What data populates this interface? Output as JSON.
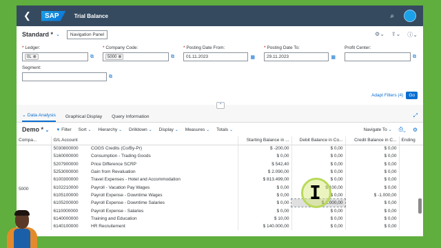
{
  "shell": {
    "logo": "SAP",
    "title": "Trial Balance"
  },
  "variant": {
    "name": "Standard *",
    "nav_panel": "Navigation Panel"
  },
  "filters": {
    "ledger": {
      "label": "Ledger:",
      "token": "0L"
    },
    "company_code": {
      "label": "Company Code:",
      "token": "5000"
    },
    "posting_from": {
      "label": "Posting Date From:",
      "value": "01.11.2023"
    },
    "posting_to": {
      "label": "Posting Date To:",
      "value": "29.11.2023"
    },
    "profit_center": {
      "label": "Profit Center:",
      "value": ""
    },
    "segment": {
      "label": "Segment:",
      "value": ""
    },
    "adapt_label": "Adapt Filters (4)",
    "go_label": "Go"
  },
  "tabs": [
    {
      "label": "Data Analysis"
    },
    {
      "label": "Graphical Display"
    },
    {
      "label": "Query Information"
    }
  ],
  "toolbar": {
    "view": "Demo *",
    "filter": "Filter",
    "sort": "Sort",
    "hierarchy": "Hierarchy",
    "drilldown": "Drilldown",
    "display": "Display",
    "measures": "Measures",
    "totals": "Totals",
    "navigate_to": "Navigate To"
  },
  "table": {
    "columns": [
      "Compa...",
      "G/L Account",
      "",
      "Starting Balance in ...",
      "Debit Balance in Co...",
      "Credit Balance in C...",
      "Ending"
    ],
    "company": "5000",
    "rows": [
      {
        "acct": "5030800000",
        "name": "COGS Credits (Co/By-Pr)",
        "start": "$ -200,00",
        "debit": "$ 0,00",
        "credit": "$ 0,00"
      },
      {
        "acct": "5160000000",
        "name": "Consumption - Trading Goods",
        "start": "$ 0,00",
        "debit": "$ 0,00",
        "credit": "$ 0,00"
      },
      {
        "acct": "5207900000",
        "name": "Price Difference SCRP",
        "start": "$ 542,40",
        "debit": "$ 0,00",
        "credit": "$ 0,00"
      },
      {
        "acct": "5253000000",
        "name": "Gain from Revaluation",
        "start": "$ 2.090,00",
        "debit": "$ 0,00",
        "credit": "$ 0,00"
      },
      {
        "acct": "6100300000",
        "name": "Travel Expenses - Hotel and Accommodation",
        "start": "$ 813.499,00",
        "debit": "$ 0,00",
        "credit": "$ 0,00"
      },
      {
        "acct": "6102210000",
        "name": "Payroll - Vacation Pay Wages",
        "start": "$ 0,00",
        "debit": "$ 100,00",
        "credit": "$ 0,00"
      },
      {
        "acct": "6105100000",
        "name": "Payroll Expense - Downtime Wages",
        "start": "$ 0,00",
        "debit": "$ 0,00",
        "credit": "$ -1.000,00"
      },
      {
        "acct": "6105200000",
        "name": "Payroll Expense - Downtime Salaries",
        "start": "$ 0,00",
        "debit": "$ 2.000,00",
        "credit": "$ 0,00"
      },
      {
        "acct": "6110000000",
        "name": "Payroll Expense - Salaries",
        "start": "$ 0,00",
        "debit": "$ 0,00",
        "credit": "$ 0,00"
      },
      {
        "acct": "6140000000",
        "name": "Training and Education",
        "start": "$ 10,00",
        "debit": "$ 0,00",
        "credit": "$ 0,00"
      },
      {
        "acct": "6140100000",
        "name": "HR Recruitement",
        "start": "$ 140.000,00",
        "debit": "$ 0,00",
        "credit": "$ 0,00"
      }
    ]
  }
}
